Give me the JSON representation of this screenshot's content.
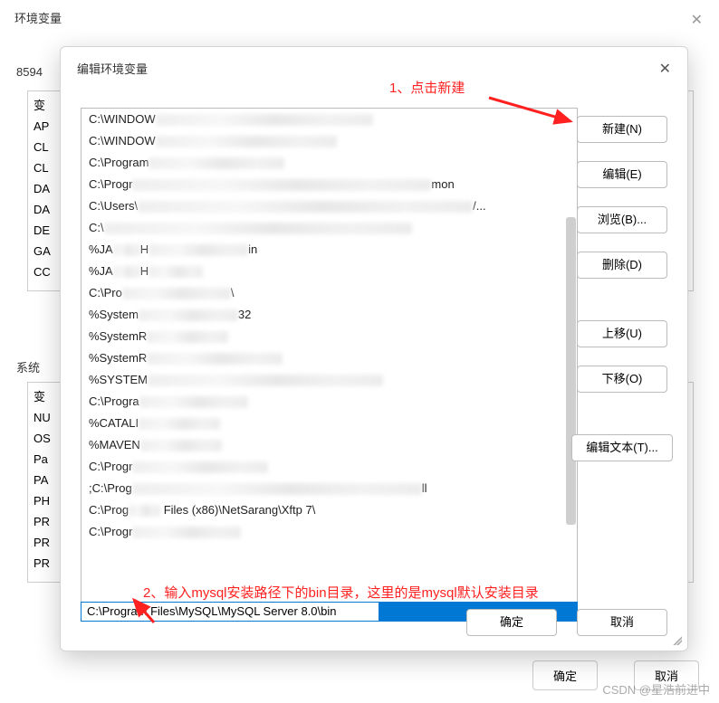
{
  "background": {
    "title": "环境变量",
    "user_section_label": "8594",
    "system_section_label": "系统",
    "user_list_prefixes": [
      "变",
      "AP",
      "CL",
      "CL",
      "DA",
      "DA",
      "DE",
      "GA",
      "CC"
    ],
    "system_list_prefixes": [
      "变",
      "NU",
      "OS",
      "Pa",
      "PA",
      "PH",
      "PR",
      "PR",
      "PR"
    ],
    "ok_label": "确定",
    "cancel_label": "取消"
  },
  "modal": {
    "title": "编辑环境变量",
    "path_items": [
      {
        "prefix": "C:\\WINDOW",
        "suffix": "",
        "blur_w": 240
      },
      {
        "prefix": "C:\\WINDOW",
        "suffix": "",
        "blur_w": 200
      },
      {
        "prefix": "C:\\Program",
        "suffix": "",
        "blur_w": 150
      },
      {
        "prefix": "C:\\Progr",
        "suffix": "mon",
        "blur_w": 330
      },
      {
        "prefix": "C:\\Users\\",
        "suffix": "/...",
        "blur_w": 370
      },
      {
        "prefix": "C:\\",
        "suffix": "",
        "blur_w": 340
      },
      {
        "prefix": "%JA",
        "middle": "H",
        "suffix": "in",
        "blur_w": 110
      },
      {
        "prefix": "%JA",
        "middle": "H",
        "suffix": "",
        "blur_w": 60
      },
      {
        "prefix": "C:\\Pro",
        "suffix": "\\",
        "blur_w": 120
      },
      {
        "prefix": "%System",
        "suffix": "32",
        "blur_w": 110
      },
      {
        "prefix": "%SystemR",
        "suffix": "",
        "blur_w": 90
      },
      {
        "prefix": "%SystemR",
        "suffix": "",
        "blur_w": 150
      },
      {
        "prefix": "%SYSTEM",
        "suffix": "",
        "blur_w": 260
      },
      {
        "prefix": "C:\\Progra",
        "suffix": "",
        "blur_w": 120
      },
      {
        "prefix": "%CATALI",
        "suffix": "",
        "blur_w": 90
      },
      {
        "prefix": "%MAVEN",
        "suffix": "",
        "blur_w": 90
      },
      {
        "prefix": "C:\\Progr",
        "suffix": "",
        "blur_w": 150
      },
      {
        "prefix": ";C:\\Prog",
        "suffix": "ll",
        "blur_w": 320
      },
      {
        "prefix": "C:\\Prog",
        "suffix": "",
        "blur_w": 35,
        "after": "Files (x86)\\NetSarang\\Xftp 7\\"
      },
      {
        "prefix": "C:\\Progr",
        "suffix": "",
        "blur_w": 120
      }
    ],
    "edit_value": "C:\\Program Files\\MySQL\\MySQL Server 8.0\\bin",
    "buttons": {
      "new": "新建(N)",
      "edit": "编辑(E)",
      "browse": "浏览(B)...",
      "delete": "删除(D)",
      "move_up": "上移(U)",
      "move_down": "下移(O)",
      "edit_text": "编辑文本(T)...",
      "ok": "确定",
      "cancel": "取消"
    }
  },
  "annotations": {
    "step1": "1、点击新建",
    "step2": "2、输入mysql安装路径下的bin目录，这里的是mysql默认安装目录"
  },
  "watermark": "CSDN @星浩前进中"
}
